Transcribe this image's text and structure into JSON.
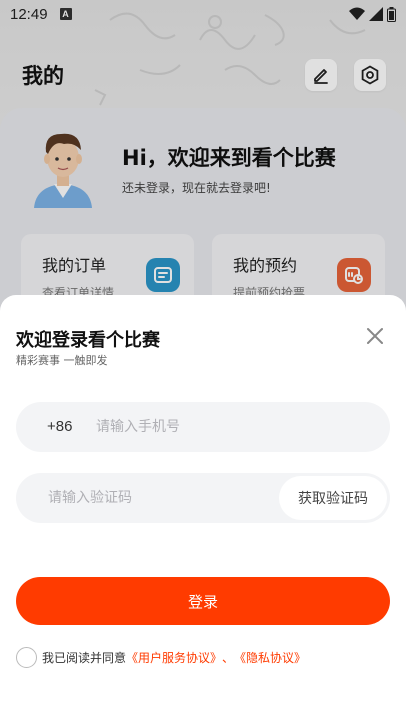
{
  "status_bar": {
    "time": "12:49",
    "app_indicator": "A",
    "icons": [
      "wifi-icon",
      "signal-icon",
      "battery-icon"
    ]
  },
  "header": {
    "title": "我的",
    "edit_icon": "edit-icon",
    "settings_icon": "settings-icon"
  },
  "profile": {
    "greeting": "Hi，欢迎来到看个比赛",
    "subtitle": "还未登录，现在就去登录吧!"
  },
  "quick_cards": [
    {
      "title": "我的订单",
      "subtitle": "查看订单详情",
      "icon": "order-icon",
      "color": "#2b96c9"
    },
    {
      "title": "我的预约",
      "subtitle": "提前预约抢票",
      "icon": "calendar-clock-icon",
      "color": "#e8643a"
    }
  ],
  "login_sheet": {
    "title": "欢迎登录看个比赛",
    "subtitle": "精彩赛事 一触即发",
    "country_code": "+86",
    "phone_placeholder": "请输入手机号",
    "code_placeholder": "请输入验证码",
    "get_code_label": "获取验证码",
    "login_label": "登录",
    "agree_prefix": "我已阅读并同意",
    "user_agreement": "《用户服务协议》",
    "separator": "、",
    "privacy_policy": "《隐私协议》"
  },
  "colors": {
    "accent": "#ff3b00",
    "field_bg": "#f3f4f6"
  }
}
